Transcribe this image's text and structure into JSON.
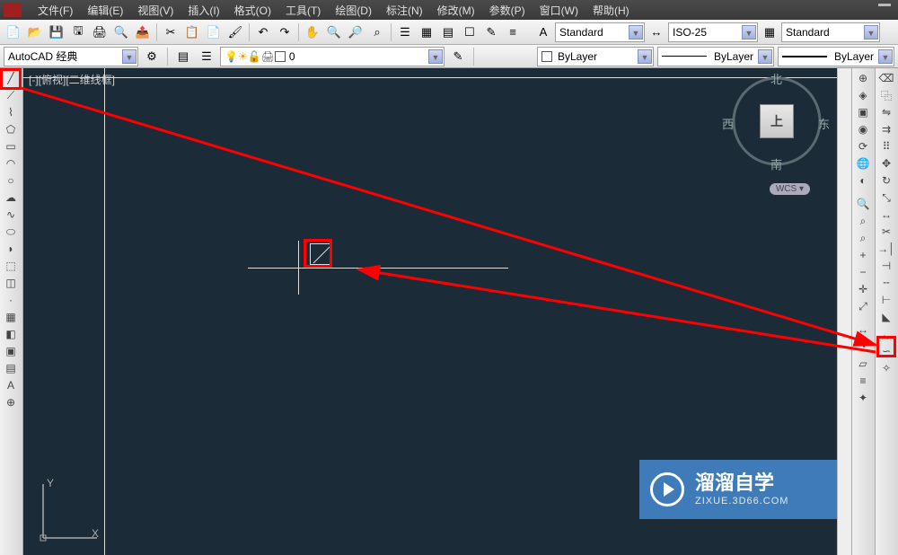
{
  "menu": {
    "items": [
      "文件(F)",
      "编辑(E)",
      "视图(V)",
      "插入(I)",
      "格式(O)",
      "工具(T)",
      "绘图(D)",
      "标注(N)",
      "修改(M)",
      "参数(P)",
      "窗口(W)",
      "帮助(H)"
    ]
  },
  "toolbar": {
    "workspace_combo": "AutoCAD 经典",
    "text_style": "Standard",
    "dim_style": "ISO-25",
    "table_style": "Standard"
  },
  "properties": {
    "layer_name": "0",
    "color_label": "ByLayer",
    "linetype_label": "ByLayer",
    "lineweight_label": "ByLayer"
  },
  "viewport": {
    "label": "[-][俯视][二维线框]"
  },
  "viewcube": {
    "face": "上",
    "north": "北",
    "south": "南",
    "east": "东",
    "west": "西",
    "wcs": "WCS"
  },
  "ucs": {
    "x": "X",
    "y": "Y"
  },
  "left_tools": [
    {
      "name": "line-tool",
      "glyph": "╱"
    },
    {
      "name": "construction-line-tool",
      "glyph": "⟋"
    },
    {
      "name": "polyline-tool",
      "glyph": "⌇"
    },
    {
      "name": "polygon-tool",
      "glyph": "⬠"
    },
    {
      "name": "rectangle-tool",
      "glyph": "▭"
    },
    {
      "name": "arc-tool",
      "glyph": "◠"
    },
    {
      "name": "circle-tool",
      "glyph": "○"
    },
    {
      "name": "revcloud-tool",
      "glyph": "☁"
    },
    {
      "name": "spline-tool",
      "glyph": "∿"
    },
    {
      "name": "ellipse-tool",
      "glyph": "⬭"
    },
    {
      "name": "ellipse-arc-tool",
      "glyph": "◗"
    },
    {
      "name": "insert-block-tool",
      "glyph": "⬚"
    },
    {
      "name": "make-block-tool",
      "glyph": "◫"
    },
    {
      "name": "point-tool",
      "glyph": "·"
    },
    {
      "name": "hatch-tool",
      "glyph": "▦"
    },
    {
      "name": "gradient-tool",
      "glyph": "◧"
    },
    {
      "name": "region-tool",
      "glyph": "▣"
    },
    {
      "name": "table-tool",
      "glyph": "▤"
    },
    {
      "name": "mtext-tool",
      "glyph": "A"
    },
    {
      "name": "addselected-tool",
      "glyph": "⊕"
    }
  ],
  "right_tools_a": [
    {
      "name": "ucs-world-icon",
      "glyph": "⊕"
    },
    {
      "name": "view-3d-icon",
      "glyph": "◈"
    },
    {
      "name": "view-top-icon",
      "glyph": "▣"
    },
    {
      "name": "view-iso-icon",
      "glyph": "◉"
    },
    {
      "name": "orbit-icon",
      "glyph": "⟳"
    },
    {
      "name": "pan-globe-icon",
      "glyph": "🌐"
    },
    {
      "name": "visual-style-icon",
      "glyph": "◐"
    }
  ],
  "right_tools_b": [
    {
      "name": "zoom-realtime-icon",
      "glyph": "🔍"
    },
    {
      "name": "zoom-window-icon",
      "glyph": "⌕"
    },
    {
      "name": "zoom-previous-icon",
      "glyph": "⌕"
    },
    {
      "name": "zoom-in-icon",
      "glyph": "+"
    },
    {
      "name": "zoom-out-icon",
      "glyph": "−"
    },
    {
      "name": "zoom-center-icon",
      "glyph": "✛"
    },
    {
      "name": "zoom-extents-icon",
      "glyph": "⤢"
    }
  ],
  "right_tools_c": [
    {
      "name": "distance-icon",
      "glyph": "↔"
    },
    {
      "name": "radius-icon",
      "glyph": "◔"
    },
    {
      "name": "area-icon",
      "glyph": "▱"
    },
    {
      "name": "list-icon",
      "glyph": "≡"
    },
    {
      "name": "id-point-icon",
      "glyph": "✦"
    }
  ],
  "far_right_tools": [
    {
      "name": "erase-tool",
      "glyph": "⌫"
    },
    {
      "name": "copy-tool",
      "glyph": "⿻"
    },
    {
      "name": "mirror-tool",
      "glyph": "⇋"
    },
    {
      "name": "offset-tool",
      "glyph": "⇉"
    },
    {
      "name": "array-tool",
      "glyph": "⠿"
    },
    {
      "name": "move-tool",
      "glyph": "✥"
    },
    {
      "name": "rotate-tool",
      "glyph": "↻"
    },
    {
      "name": "scale-tool",
      "glyph": "⤡"
    },
    {
      "name": "stretch-tool",
      "glyph": "↔"
    },
    {
      "name": "trim-tool",
      "glyph": "✂"
    },
    {
      "name": "extend-tool",
      "glyph": "→│"
    },
    {
      "name": "break-at-point-tool",
      "glyph": "⊣"
    },
    {
      "name": "break-tool",
      "glyph": "╌"
    },
    {
      "name": "join-tool",
      "glyph": "⊢"
    },
    {
      "name": "chamfer-tool",
      "glyph": "◣"
    },
    {
      "name": "fillet-tool",
      "glyph": "◟"
    },
    {
      "name": "blend-tool",
      "glyph": "∽"
    },
    {
      "name": "explode-tool",
      "glyph": "✧"
    }
  ],
  "watermark": {
    "title": "溜溜自学",
    "sub": "ZIXUE.3D66.COM"
  },
  "colors": {
    "canvas_bg": "#1b2b38",
    "annotation_red": "#ff0000"
  }
}
